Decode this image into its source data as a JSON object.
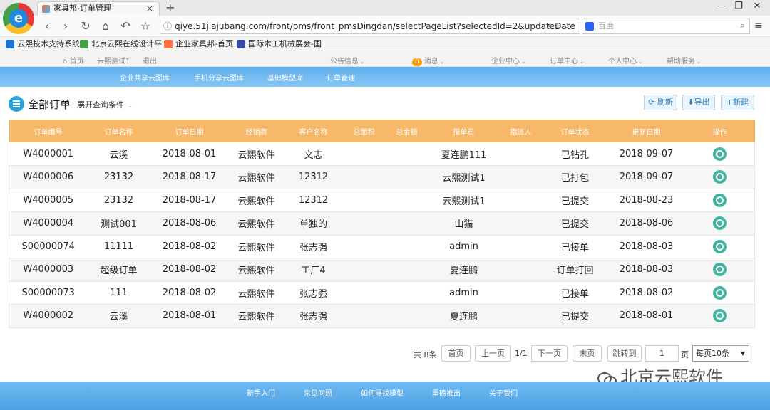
{
  "browser": {
    "tab_title": "家具邦-订单管理",
    "tab_close": "×",
    "new_tab": "+",
    "win_min": "—",
    "win_max": "❐",
    "win_close": "✕",
    "url": "qiye.51jiajubang.com/front/pms/front_pmsDingdan/selectPageList?selectedId=2&updateDate_...",
    "search_placeholder": "百度",
    "bookmarks": [
      "云熙技术支持系统",
      "北京云熙在线设计平",
      "企业家具邦-首页",
      "国际木工机械展会-国"
    ]
  },
  "topnav": {
    "home": "首页",
    "user": "云熙测试1",
    "logout": "退出",
    "notice": "公告信息",
    "msg_count": "0",
    "msg": "消息",
    "enterprise": "企业中心",
    "orders": "订单中心",
    "personal": "个人中心",
    "help": "帮助服务"
  },
  "subnav": [
    "企业共享云图库",
    "手机分享云图库",
    "基础模型库",
    "订单管理"
  ],
  "content": {
    "title": "全部订单",
    "expand": "展开查询条件",
    "refresh": "刷新",
    "export": "导出",
    "create": "新建"
  },
  "table": {
    "columns": [
      "订单编号",
      "订单名称",
      "订单日期",
      "经销商",
      "客户名称",
      "总面积",
      "总金额",
      "接单员",
      "指派人",
      "订单状态",
      "更新日期",
      "操作"
    ],
    "rows": [
      [
        "W4000001",
        "云溪",
        "2018-08-01",
        "云熙软件",
        "文志",
        "",
        "",
        "夏连鹏111",
        "",
        "已钻孔",
        "2018-09-07"
      ],
      [
        "W4000006",
        "23132",
        "2018-08-17",
        "云熙软件",
        "12312",
        "",
        "",
        "云熙测试1",
        "",
        "已打包",
        "2018-09-07"
      ],
      [
        "W4000005",
        "23132",
        "2018-08-17",
        "云熙软件",
        "12312",
        "",
        "",
        "云熙测试1",
        "",
        "已提交",
        "2018-08-23"
      ],
      [
        "W4000004",
        "测试001",
        "2018-08-06",
        "云熙软件",
        "单独的",
        "",
        "",
        "山猫",
        "",
        "已提交",
        "2018-08-06"
      ],
      [
        "S00000074",
        "11111",
        "2018-08-02",
        "云熙软件",
        "张志强",
        "",
        "",
        "admin",
        "",
        "已接单",
        "2018-08-03"
      ],
      [
        "W4000003",
        "超级订单",
        "2018-08-02",
        "云熙软件",
        "工厂4",
        "",
        "",
        "夏连鹏",
        "",
        "订单打回",
        "2018-08-03"
      ],
      [
        "S00000073",
        "111",
        "2018-08-02",
        "云熙软件",
        "张志强",
        "",
        "",
        "admin",
        "",
        "已接单",
        "2018-08-02"
      ],
      [
        "W4000002",
        "云溪",
        "2018-08-01",
        "云熙软件",
        "张志强",
        "",
        "",
        "夏连鹏",
        "",
        "已提交",
        "2018-08-01"
      ]
    ]
  },
  "pager": {
    "total": "共 8条",
    "first": "首页",
    "prev": "上一页",
    "current": "1/1",
    "next": "下一页",
    "last": "末页",
    "jump": "跳转到",
    "page_value": "1",
    "page_unit": "页",
    "page_size": "每页10条"
  },
  "watermark": "北京云熙软件",
  "footer": [
    "新手入门",
    "常见问题",
    "如何寻找模型",
    "重磅推出",
    "关于我们"
  ],
  "colors": {
    "header_orange": "#f7b86a",
    "nav_blue": "#5fb0ee",
    "action_teal": "#3fb5a3"
  }
}
